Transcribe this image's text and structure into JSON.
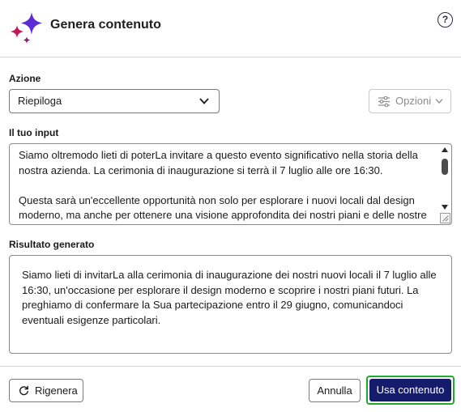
{
  "header": {
    "title": "Genera contenuto",
    "help_glyph": "?"
  },
  "icons": {
    "logo": "sparkle-logo-icon",
    "help": "help-icon",
    "select_chevron": "chevron-down-icon",
    "options": "sliders-icon",
    "regenerate": "refresh-icon"
  },
  "colors": {
    "primary": "#151c6b",
    "focus_ring": "#1eaa2e",
    "sparkle_purple": "#5b2bd6",
    "sparkle_red": "#c2185b"
  },
  "action": {
    "label": "Azione",
    "selected": "Riepiloga"
  },
  "options_button": {
    "label": "Opzioni"
  },
  "input": {
    "label": "Il tuo input",
    "text": "Siamo oltremodo lieti di poterLa invitare a questo evento significativo nella storia della nostra azienda. La cerimonia di inaugurazione si terrà il 7 luglio alle ore 16:30.\n\nQuesta sarà un'eccellente opportunità non solo per esplorare i nuovi locali dal design moderno, ma anche per ottenere una visione approfondita dei nostri piani e delle nostre visioni future. È un'occasione per condividere con voi i nostri progetti e obiettivi."
  },
  "output": {
    "label": "Risultato generato",
    "text": "Siamo lieti di invitarLa alla cerimonia di inaugurazione dei nostri nuovi locali il 7 luglio alle 16:30, un'occasione per esplorare il design moderno e scoprire i nostri piani futuri. La preghiamo di confermare la Sua partecipazione entro il 29 giugno, comunicandoci eventuali esigenze particolari."
  },
  "footer": {
    "regenerate": "Rigenera",
    "cancel": "Annulla",
    "use": "Usa contenuto"
  }
}
